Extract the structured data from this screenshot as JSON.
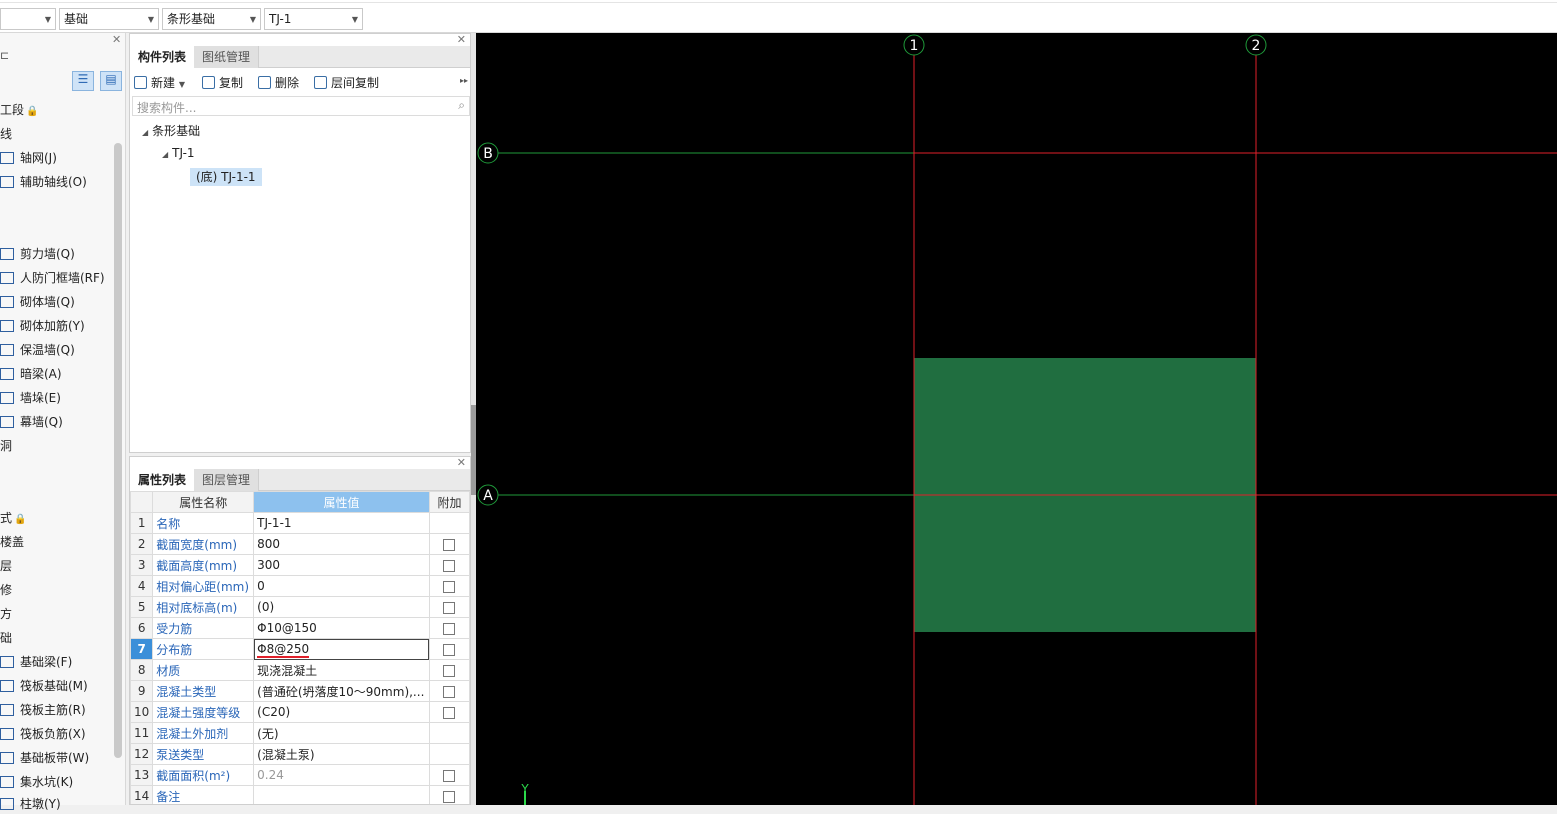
{
  "toolbar": {
    "combos": [
      {
        "value": ""
      },
      {
        "value": "基础"
      },
      {
        "value": "条形基础"
      },
      {
        "value": "TJ-1"
      }
    ]
  },
  "leftnav": {
    "items": [
      {
        "label": "工段",
        "lock": "🔒"
      },
      {
        "label": "线"
      },
      {
        "label": "轴网(J)"
      },
      {
        "label": "辅助轴线(O)"
      },
      {
        "label": "剪力墙(Q)"
      },
      {
        "label": "人防门框墙(RF)"
      },
      {
        "label": "砌体墙(Q)"
      },
      {
        "label": "砌体加筋(Y)"
      },
      {
        "label": "保温墙(Q)"
      },
      {
        "label": "暗梁(A)"
      },
      {
        "label": "墙垛(E)"
      },
      {
        "label": "幕墙(Q)"
      },
      {
        "label": "洞"
      },
      {
        "label": "式",
        "lock": "🔒"
      },
      {
        "label": "楼盖"
      },
      {
        "label": "层"
      },
      {
        "label": "修"
      },
      {
        "label": "方"
      },
      {
        "label": "础"
      },
      {
        "label": "基础梁(F)"
      },
      {
        "label": "筏板基础(M)"
      },
      {
        "label": "筏板主筋(R)"
      },
      {
        "label": "筏板负筋(X)"
      },
      {
        "label": "基础板带(W)"
      },
      {
        "label": "集水坑(K)"
      },
      {
        "label": "柱墩(Y)"
      }
    ]
  },
  "component_panel": {
    "tabs": [
      "构件列表",
      "图纸管理"
    ],
    "actions": {
      "new": "新建",
      "copy": "复制",
      "delete": "删除",
      "floor_copy": "层间复制"
    },
    "search_placeholder": "搜索构件...",
    "tree": {
      "root": "条形基础",
      "child": "TJ-1",
      "leaf": "(底) TJ-1-1"
    }
  },
  "property_panel": {
    "tabs": [
      "属性列表",
      "图层管理"
    ],
    "headers": {
      "name": "属性名称",
      "value": "属性值",
      "extra": "附加"
    },
    "rows": [
      {
        "num": "1",
        "name": "名称",
        "value": "TJ-1-1",
        "checkbox": false
      },
      {
        "num": "2",
        "name": "截面宽度(mm)",
        "value": "800",
        "checkbox": true
      },
      {
        "num": "3",
        "name": "截面高度(mm)",
        "value": "300",
        "checkbox": true
      },
      {
        "num": "4",
        "name": "相对偏心距(mm)",
        "value": "0",
        "checkbox": true
      },
      {
        "num": "5",
        "name": "相对底标高(m)",
        "value": "(0)",
        "checkbox": true
      },
      {
        "num": "6",
        "name": "受力筋",
        "value": "Φ10@150",
        "checkbox": true
      },
      {
        "num": "7",
        "name": "分布筋",
        "value": "Φ8@250",
        "checkbox": true
      },
      {
        "num": "8",
        "name": "材质",
        "value": "现浇混凝土",
        "checkbox": true
      },
      {
        "num": "9",
        "name": "混凝土类型",
        "value": "(普通砼(坍落度10～90mm),...",
        "checkbox": true
      },
      {
        "num": "10",
        "name": "混凝土强度等级",
        "value": "(C20)",
        "checkbox": true
      },
      {
        "num": "11",
        "name": "混凝土外加剂",
        "value": "(无)",
        "checkbox": false
      },
      {
        "num": "12",
        "name": "泵送类型",
        "value": "(混凝土泵)",
        "checkbox": false
      },
      {
        "num": "13",
        "name": "截面面积(m²)",
        "value": "0.24",
        "checkbox": true
      },
      {
        "num": "14",
        "name": "备注",
        "value": "",
        "checkbox": true
      }
    ]
  },
  "canvas": {
    "background": "#000000",
    "grid_color": "#e0202a",
    "axis_color_green": "#1f9a3a",
    "strip_color": "#206e40",
    "axis_labels": {
      "one": "1",
      "two": "2",
      "a": "A",
      "b": "B",
      "y": "Y"
    }
  }
}
